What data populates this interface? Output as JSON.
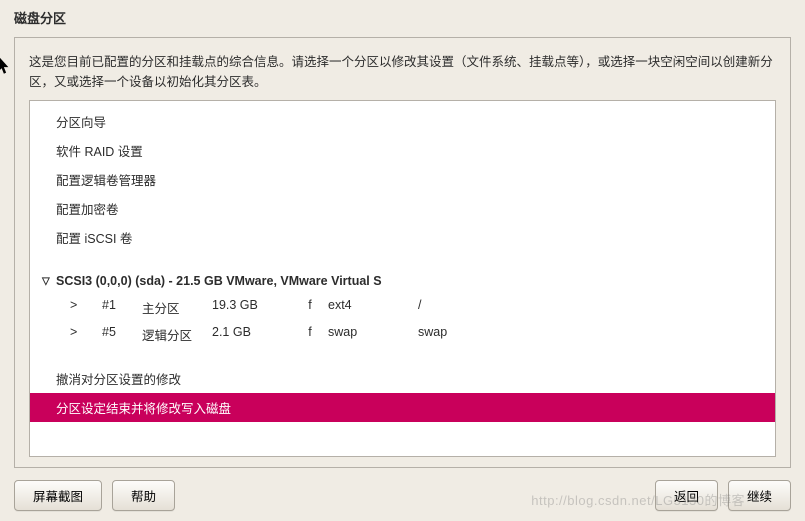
{
  "title": "磁盘分区",
  "description": "这是您目前已配置的分区和挂载点的综合信息。请选择一个分区以修改其设置（文件系统、挂载点等），或选择一块空闲空间以创建新分区，又或选择一个设备以初始化其分区表。",
  "menu": {
    "guided": "分区向导",
    "raid": "软件 RAID 设置",
    "lvm": "配置逻辑卷管理器",
    "crypt": "配置加密卷",
    "iscsi": "配置 iSCSI 卷"
  },
  "device": {
    "expander": "▽",
    "label": "SCSI3 (0,0,0) (sda) - 21.5 GB VMware, VMware Virtual S"
  },
  "partitions": [
    {
      "mark": ">",
      "num": "#1",
      "type": "主分区",
      "size": "19.3 GB",
      "flag": "f",
      "fs": "ext4",
      "mnt": "/"
    },
    {
      "mark": ">",
      "num": "#5",
      "type": "逻辑分区",
      "size": "2.1 GB",
      "flag": "f",
      "fs": "swap",
      "mnt": "swap"
    }
  ],
  "actions": {
    "undo": "撤消对分区设置的修改",
    "finish": "分区设定结束并将修改写入磁盘"
  },
  "buttons": {
    "screenshot": "屏幕截图",
    "help": "帮助",
    "back": "返回",
    "continue": "继续"
  },
  "watermark": "http://blog.csdn.net/LG5130的博客"
}
